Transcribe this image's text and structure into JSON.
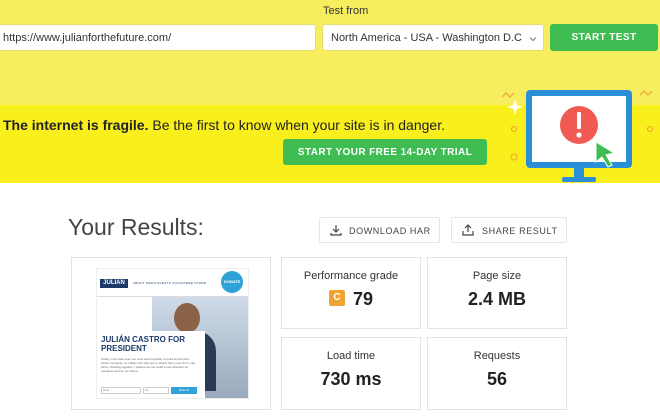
{
  "test_form": {
    "url_value": "https://www.julianforthefuture.com/",
    "test_from_label": "Test from",
    "region_value": "North America - USA - Washington D.C",
    "start_label": "START TEST"
  },
  "banner": {
    "headline_bold": "The internet is fragile.",
    "headline_rest": " Be the first to know when your site is in danger.",
    "trial_label": "START YOUR FREE 14-DAY TRIAL"
  },
  "results": {
    "title": "Your Results:",
    "download_label": "DOWNLOAD HAR",
    "share_label": "SHARE RESULT",
    "metrics": [
      {
        "label": "Performance grade",
        "grade": "C",
        "value": "79"
      },
      {
        "label": "Page size",
        "value": "2.4 MB"
      },
      {
        "label": "Load time",
        "value": "730 ms"
      },
      {
        "label": "Requests",
        "value": "56"
      }
    ]
  },
  "screenshot": {
    "logo": "JULIAN",
    "nav": "ABOUT  NEWS  EVENTS  VOLUNTEER  STORE",
    "donate": "DONATE",
    "hero_title": "JULIÁN CASTRO FOR PRESIDENT",
    "hero_text": "Today, more than ever, we must work together to build an America where everyone, no matter who they are or where they come from, can thrive. Working together, I believe we can build a new direction for ourselves and for our future.",
    "form_email": "Email",
    "form_zip": "Zip",
    "form_button": "SIGN UP"
  },
  "colors": {
    "top_bg": "#f6ee5e",
    "banner_bg": "#f9ef1d",
    "accent_green": "#3fbd52",
    "grade_c": "#f0a333"
  }
}
